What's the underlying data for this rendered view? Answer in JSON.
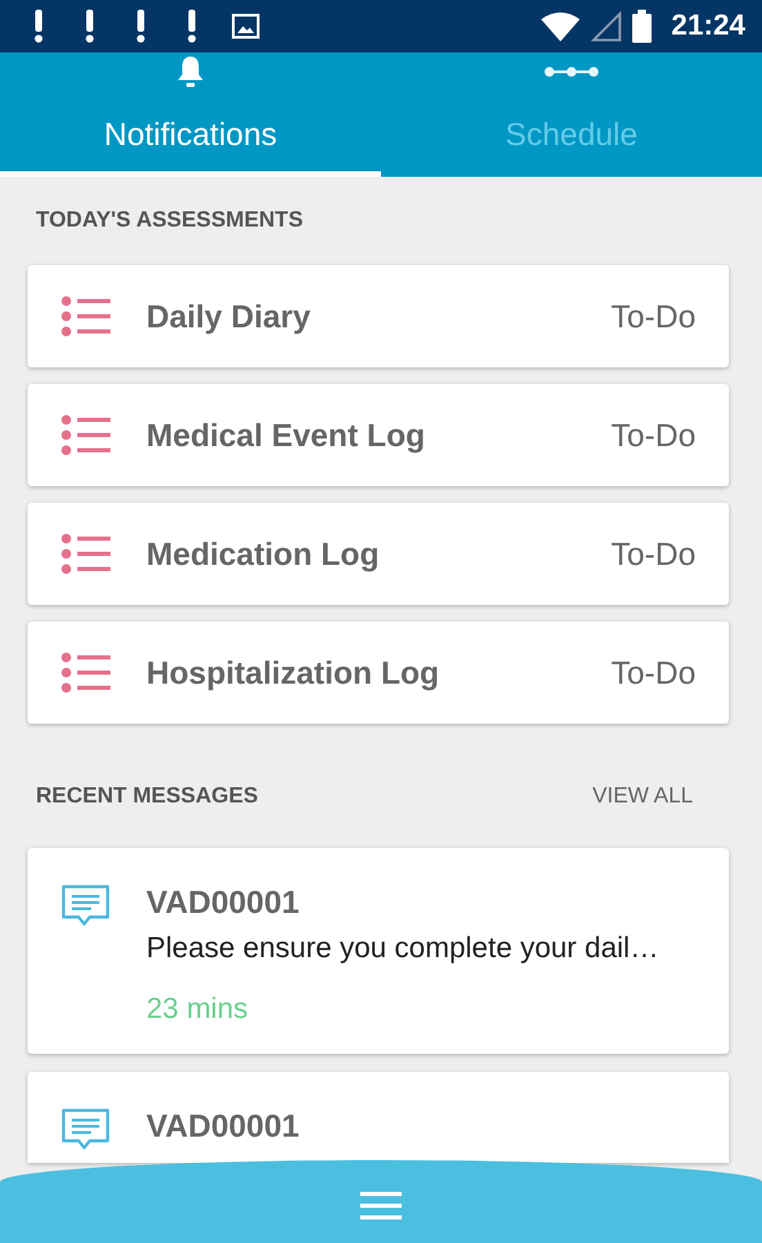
{
  "status_bar": {
    "time": "21:24"
  },
  "tabs": [
    {
      "label": "Notifications",
      "selected": true
    },
    {
      "label": "Schedule",
      "selected": false
    }
  ],
  "assessments": {
    "heading": "TODAY'S ASSESSMENTS",
    "items": [
      {
        "title": "Daily Diary",
        "status": "To-Do"
      },
      {
        "title": "Medical Event Log",
        "status": "To-Do"
      },
      {
        "title": "Medication Log",
        "status": "To-Do"
      },
      {
        "title": "Hospitalization Log",
        "status": "To-Do"
      }
    ]
  },
  "messages": {
    "heading": "RECENT MESSAGES",
    "view_all": "VIEW ALL",
    "items": [
      {
        "sender": "VAD00001",
        "text": "Please ensure you complete your dail…",
        "time": "23 mins"
      },
      {
        "sender": "VAD00001"
      }
    ]
  }
}
